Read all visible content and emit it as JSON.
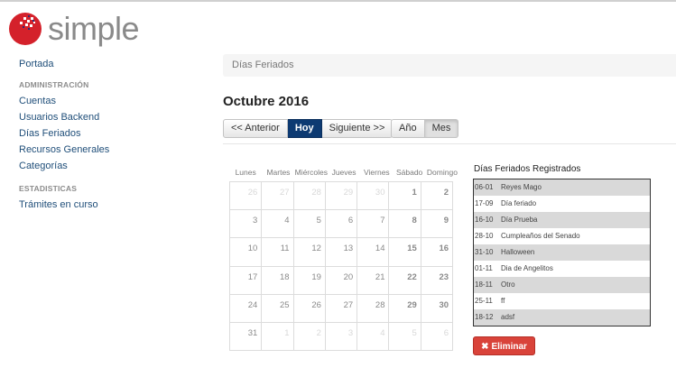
{
  "app": {
    "logo_text": "simple"
  },
  "sidebar": {
    "portada": "Portada",
    "admin_header": "ADMINISTRACIÓN",
    "admin_items": [
      "Cuentas",
      "Usuarios Backend",
      "Días Feriados",
      "Recursos Generales",
      "Categorías"
    ],
    "stats_header": "ESTADISTICAS",
    "stats_items": [
      "Trámites en curso"
    ]
  },
  "breadcrumb": "Días Feriados",
  "page_title": "Octubre 2016",
  "nav": {
    "prev": "<< Anterior",
    "today": "Hoy",
    "next": "Siguiente >>"
  },
  "view": {
    "year": "Año",
    "month": "Mes",
    "selected": "month"
  },
  "calendar": {
    "weekdays": [
      "Lunes",
      "Martes",
      "Miércoles",
      "Jueves",
      "Viernes",
      "Sábado",
      "Domingo"
    ],
    "weeks": [
      [
        "26",
        "27",
        "28",
        "29",
        "30",
        "1",
        "2"
      ],
      [
        "3",
        "4",
        "5",
        "6",
        "7",
        "8",
        "9"
      ],
      [
        "10",
        "11",
        "12",
        "13",
        "14",
        "15",
        "16"
      ],
      [
        "17",
        "18",
        "19",
        "20",
        "21",
        "22",
        "23"
      ],
      [
        "24",
        "25",
        "26",
        "27",
        "28",
        "29",
        "30"
      ],
      [
        "31",
        "1",
        "2",
        "3",
        "4",
        "5",
        "6"
      ]
    ],
    "outside_month": [
      [
        0,
        0
      ],
      [
        0,
        1
      ],
      [
        0,
        2
      ],
      [
        0,
        3
      ],
      [
        0,
        4
      ],
      [
        5,
        1
      ],
      [
        5,
        2
      ],
      [
        5,
        3
      ],
      [
        5,
        4
      ],
      [
        5,
        5
      ],
      [
        5,
        6
      ]
    ]
  },
  "holidays": {
    "title": "Días Feriados Registrados",
    "items": [
      {
        "date": "06-01",
        "name": "Reyes Mago"
      },
      {
        "date": "17-09",
        "name": "Día feriado"
      },
      {
        "date": "16-10",
        "name": "Día Prueba"
      },
      {
        "date": "28-10",
        "name": "Cumpleaños del Senado"
      },
      {
        "date": "31-10",
        "name": "Halloween"
      },
      {
        "date": "01-11",
        "name": "Dia de Angelitos"
      },
      {
        "date": "18-11",
        "name": "Otro"
      },
      {
        "date": "25-11",
        "name": "ff"
      },
      {
        "date": "18-12",
        "name": "adsf"
      }
    ],
    "delete_label": "Eliminar"
  },
  "colors": {
    "primary": "#0d3a72",
    "danger": "#d9433a",
    "link": "#1f4e79"
  }
}
